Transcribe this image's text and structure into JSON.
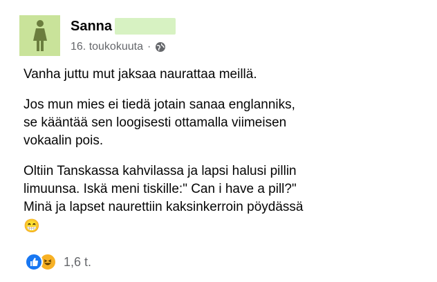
{
  "post": {
    "author_name": "Sanna",
    "date": "16. toukokuuta",
    "separator": "·",
    "privacy_icon": "globe-icon",
    "paragraphs": [
      "Vanha juttu mut jaksaa naurattaa meillä.",
      "Jos mun mies ei tiedä jotain sanaa englanniks,\nse kääntää sen loogisesti ottamalla viimeisen\nvokaalin pois.",
      " Oltiin Tanskassa kahvilassa ja lapsi halusi pillin\nlimuunsa. Iskä meni tiskille:\" Can i have a pill?\"\nMinä ja lapset naurettiin kaksinkerroin pöydässä"
    ],
    "emoji": "😁",
    "reactions": {
      "icons": [
        "like-icon",
        "haha-icon"
      ],
      "count": "1,6 t."
    }
  },
  "colors": {
    "avatar_bg": "#c9e39a",
    "redaction": "#d7f2c2",
    "meta_text": "#65676b",
    "like_blue": "#1877f2",
    "haha_yellow": "#f7b125"
  }
}
